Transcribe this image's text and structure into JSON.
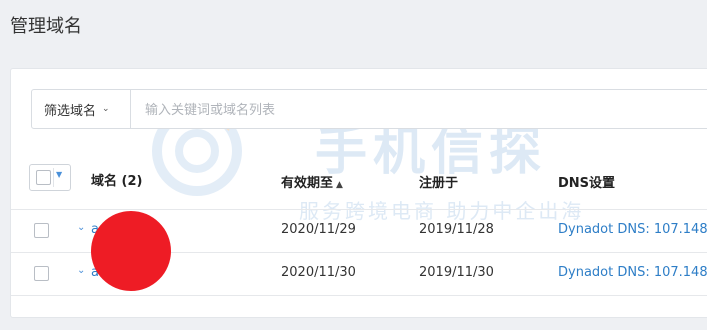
{
  "page": {
    "title": "管理域名"
  },
  "filter": {
    "select_label": "筛选域名",
    "input_placeholder": "输入关键词或域名列表"
  },
  "watermark": {
    "title": "手机信探",
    "subtitle": "服务跨境电商 助力中企出海"
  },
  "table": {
    "headers": {
      "domain": "域名 (2)",
      "expires": "有效期至",
      "registered": "注册于",
      "dns": "DNS设置"
    },
    "rows": [
      {
        "domain": "a… best",
        "expires": "2020/11/29",
        "registered": "2019/11/28",
        "dns": "Dynadot DNS: 107.148."
      },
      {
        "domain": "a… n",
        "expires": "2020/11/30",
        "registered": "2019/11/30",
        "dns": "Dynadot DNS: 107.148."
      }
    ]
  },
  "colors": {
    "link": "#2e7ec7",
    "redaction": "#ee1c25",
    "background": "#eef0f3"
  }
}
